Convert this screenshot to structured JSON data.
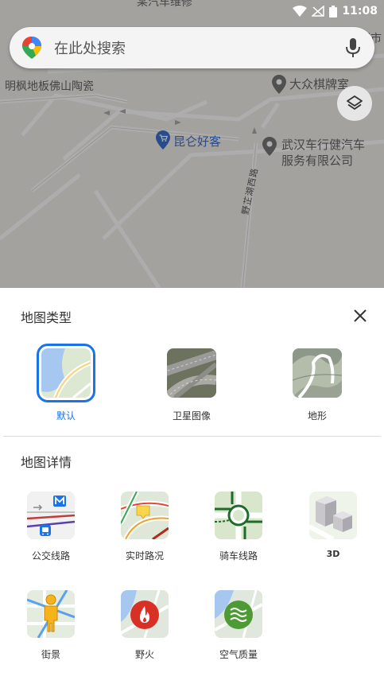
{
  "status_bar": {
    "time": "11:08",
    "colors": {
      "icons": "#ffffff"
    }
  },
  "map": {
    "labels": {
      "top_partial": "某汽车维修",
      "tile_store": "明枫地板佛山陶瓷",
      "chess_shop": "大众棋牌室",
      "kunlun": "昆仑好客",
      "car_service": "武汉车行健汽车服务有限公司",
      "road": "野芷湖西路",
      "super_partial": "超市"
    },
    "colors": {
      "poi_blue": "#3b6fcf",
      "poi_gray": "#767676",
      "dim": "rgba(0,0,0,0.32)"
    }
  },
  "search": {
    "placeholder": "在此处搜索",
    "icons": [
      "google-maps-pin-icon",
      "mic-icon"
    ]
  },
  "layers_button": {
    "icon": "layers-icon"
  },
  "sheet": {
    "map_type_title": "地图类型",
    "close_icon": "close-icon",
    "map_types": [
      {
        "label": "默认",
        "selected": true,
        "icon": "default-map-thumbnail"
      },
      {
        "label": "卫星图像",
        "selected": false,
        "icon": "satellite-thumbnail"
      },
      {
        "label": "地形",
        "selected": false,
        "icon": "terrain-thumbnail"
      }
    ],
    "map_details_title": "地图详情",
    "map_details": [
      {
        "label": "公交线路",
        "icon": "transit-icon"
      },
      {
        "label": "实时路况",
        "icon": "traffic-icon"
      },
      {
        "label": "骑车线路",
        "icon": "bicycle-icon"
      },
      {
        "label": "3D",
        "icon": "3d-buildings-icon"
      },
      {
        "label": "街景",
        "icon": "street-view-icon"
      },
      {
        "label": "野火",
        "icon": "wildfire-icon"
      },
      {
        "label": "空气质量",
        "icon": "air-quality-icon"
      }
    ],
    "colors": {
      "accent": "#1a73e8",
      "text": "#333333",
      "divider": "#dcdcdc"
    }
  }
}
